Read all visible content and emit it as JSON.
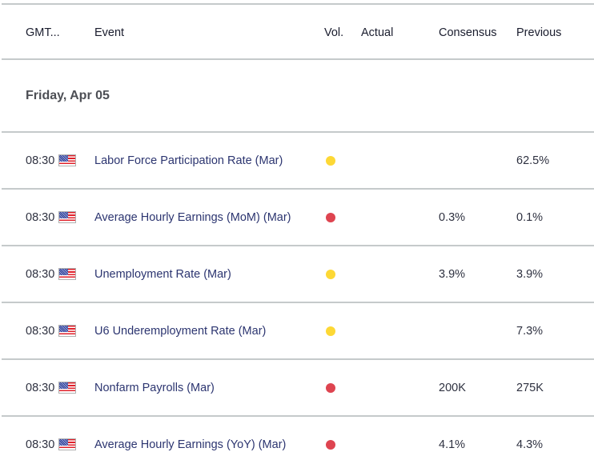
{
  "columns": {
    "time": "GMT...",
    "event": "Event",
    "vol": "Vol.",
    "actual": "Actual",
    "consensus": "Consensus",
    "previous": "Previous"
  },
  "date_group": "Friday, Apr 05",
  "volatility_colors": {
    "medium": "#fdd835",
    "high": "#de4450"
  },
  "events": [
    {
      "time": "08:30",
      "country_flag": "us-flag-icon",
      "event": "Labor Force Participation Rate (Mar)",
      "volatility": "medium",
      "actual": "",
      "consensus": "",
      "previous": "62.5%"
    },
    {
      "time": "08:30",
      "country_flag": "us-flag-icon",
      "event": "Average Hourly Earnings (MoM) (Mar)",
      "volatility": "high",
      "actual": "",
      "consensus": "0.3%",
      "previous": "0.1%"
    },
    {
      "time": "08:30",
      "country_flag": "us-flag-icon",
      "event": "Unemployment Rate (Mar)",
      "volatility": "medium",
      "actual": "",
      "consensus": "3.9%",
      "previous": "3.9%"
    },
    {
      "time": "08:30",
      "country_flag": "us-flag-icon",
      "event": "U6 Underemployment Rate (Mar)",
      "volatility": "medium",
      "actual": "",
      "consensus": "",
      "previous": "7.3%"
    },
    {
      "time": "08:30",
      "country_flag": "us-flag-icon",
      "event": "Nonfarm Payrolls (Mar)",
      "volatility": "high",
      "actual": "",
      "consensus": "200K",
      "previous": "275K"
    },
    {
      "time": "08:30",
      "country_flag": "us-flag-icon",
      "event": "Average Hourly Earnings (YoY) (Mar)",
      "volatility": "high",
      "actual": "",
      "consensus": "4.1%",
      "previous": "4.3%"
    }
  ]
}
